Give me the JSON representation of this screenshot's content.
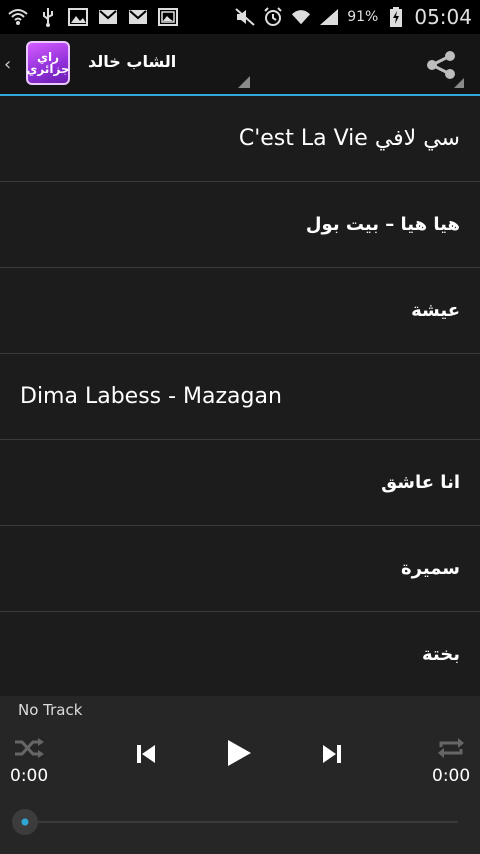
{
  "status_bar": {
    "battery_percent_label": "91%",
    "time": "05:04",
    "icons_left": [
      "wifi-icon",
      "usb-icon",
      "image-icon",
      "gmail-icon",
      "gmail-icon",
      "gallery-icon"
    ],
    "icons_right": [
      "mute-icon",
      "alarm-icon",
      "wifi-signal-icon",
      "cell-signal-icon",
      "battery-charging-icon"
    ]
  },
  "action_bar": {
    "logo_text_line1": "راي",
    "logo_text_line2": "جزائري",
    "title": "الشاب خالد",
    "accent_color": "#2fa8d8"
  },
  "tracks": [
    {
      "title": "سي لافي C'est La Vie"
    },
    {
      "title": "هيا هيا – بيت بول"
    },
    {
      "title": "عيشة"
    },
    {
      "title": "Dima Labess - Mazagan"
    },
    {
      "title": "انا عاشق"
    },
    {
      "title": "سميرة"
    },
    {
      "title": "بختة"
    }
  ],
  "player": {
    "now_playing": "No Track",
    "elapsed": "0:00",
    "duration": "0:00",
    "progress": 0
  }
}
